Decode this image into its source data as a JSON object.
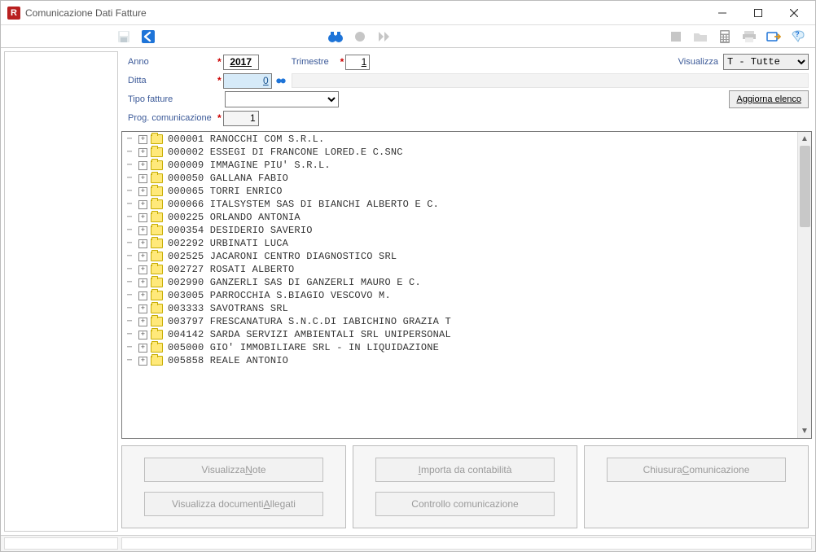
{
  "window": {
    "title": "Comunicazione Dati Fatture"
  },
  "filters": {
    "anno_label": "Anno",
    "anno_value": "2017",
    "trimestre_label": "Trimestre",
    "trimestre_value": "1",
    "visualizza_label": "Visualizza",
    "visualizza_value": "T - Tutte",
    "ditta_label": "Ditta",
    "ditta_value": "0",
    "tipo_label": "Tipo fatture",
    "tipo_value": "",
    "aggiorna_label": "Aggiorna elenco",
    "prog_label": "Prog. comunicazione",
    "prog_value": "1"
  },
  "tree": [
    "000001 RANOCCHI COM S.R.L.",
    "000002 ESSEGI DI FRANCONE LORED.E C.SNC",
    "000009 IMMAGINE PIU' S.R.L.",
    "000050 GALLANA FABIO",
    "000065 TORRI ENRICO",
    "000066 ITALSYSTEM SAS DI BIANCHI ALBERTO E C.",
    "000225 ORLANDO ANTONIA",
    "000354 DESIDERIO SAVERIO",
    "002292 URBINATI LUCA",
    "002525 JACARONI CENTRO DIAGNOSTICO SRL",
    "002727 ROSATI ALBERTO",
    "002990 GANZERLI SAS DI GANZERLI MAURO E C.",
    "003005 PARROCCHIA S.BIAGIO VESCOVO M.",
    "003333 SAVOTRANS SRL",
    "003797 FRESCANATURA S.N.C.DI IABICHINO GRAZIA T",
    "004142 SARDA SERVIZI AMBIENTALI SRL UNIPERSONAL",
    "005000 GIO' IMMOBILIARE SRL - IN LIQUIDAZIONE",
    "005858 REALE ANTONIO"
  ],
  "buttons": {
    "vis_note_pre": "Visualizza ",
    "vis_note_ul": "N",
    "vis_note_post": "ote",
    "vis_alleg_pre": "Visualizza documenti ",
    "vis_alleg_ul": "A",
    "vis_alleg_post": "llegati",
    "importa_pre": "",
    "importa_ul": "I",
    "importa_post": "mporta da contabilità",
    "controllo": "Controllo comunicazione",
    "chiusura_pre": "Chiusura ",
    "chiusura_ul": "C",
    "chiusura_post": "omunicazione"
  }
}
